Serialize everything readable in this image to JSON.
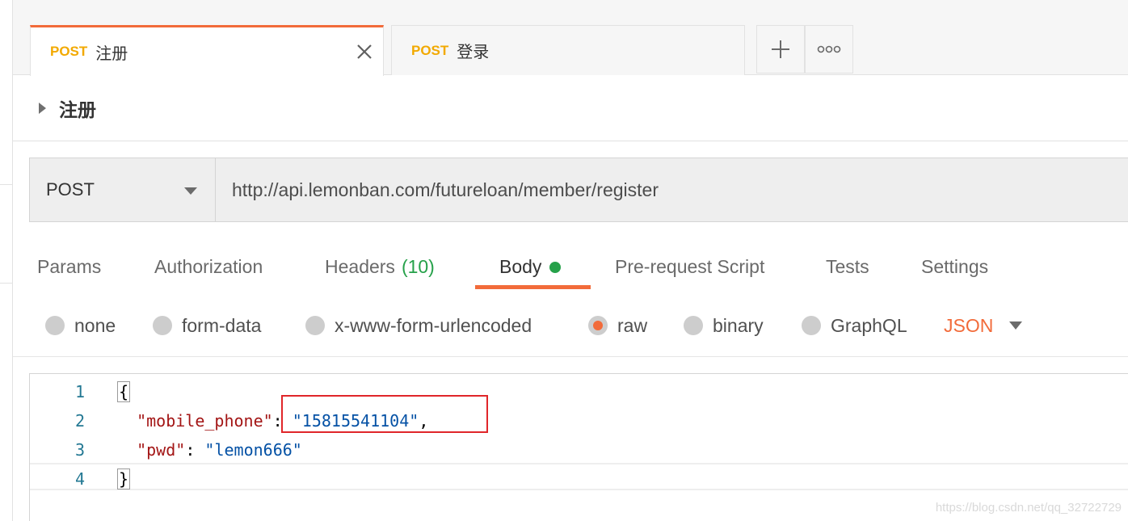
{
  "tabs": [
    {
      "method": "POST",
      "name": "注册",
      "active": true
    },
    {
      "method": "POST",
      "name": "登录",
      "active": false
    }
  ],
  "tab_actions": [
    "plus-icon",
    "more-icon"
  ],
  "request": {
    "title": "注册",
    "method": "POST",
    "url": "http://api.lemonban.com/futureloan/member/register"
  },
  "request_tabs": {
    "params": "Params",
    "authorization": "Authorization",
    "headers": "Headers",
    "headers_count": "(10)",
    "body": "Body",
    "prerequest": "Pre-request Script",
    "tests": "Tests",
    "settings": "Settings"
  },
  "body_types": {
    "none": "none",
    "form_data": "form-data",
    "urlencoded": "x-www-form-urlencoded",
    "raw": "raw",
    "binary": "binary",
    "graphql": "GraphQL",
    "selected": "raw",
    "language": "JSON"
  },
  "editor": {
    "lines": [
      {
        "num": "1",
        "open": "{"
      },
      {
        "num": "2",
        "key": "\"mobile_phone\"",
        "sep": ": ",
        "value": "\"15815541104\"",
        "tail": ","
      },
      {
        "num": "3",
        "key": "\"pwd\"",
        "sep": ": ",
        "value": "\"lemon666\"",
        "tail": ""
      },
      {
        "num": "4",
        "close": "}"
      }
    ]
  },
  "colors": {
    "accent": "#f26b3a",
    "method_post": "#f2a900",
    "green": "#26a14a",
    "highlight_box": "#e0262a"
  },
  "watermark": "https://blog.csdn.net/qq_32722729"
}
